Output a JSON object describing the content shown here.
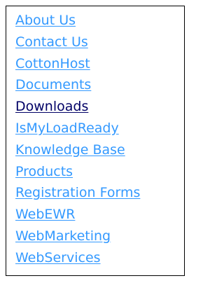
{
  "nav": {
    "link_color": "#3399ff",
    "active_color": "#000066",
    "items": [
      {
        "label": "About Us",
        "active": false
      },
      {
        "label": "Contact Us",
        "active": false
      },
      {
        "label": "CottonHost",
        "active": false
      },
      {
        "label": "Documents",
        "active": false
      },
      {
        "label": "Downloads",
        "active": true
      },
      {
        "label": "IsMyLoadReady",
        "active": false
      },
      {
        "label": "Knowledge Base",
        "active": false
      },
      {
        "label": "Products",
        "active": false
      },
      {
        "label": "Registration Forms",
        "active": false
      },
      {
        "label": "WebEWR",
        "active": false
      },
      {
        "label": "WebMarketing",
        "active": false
      },
      {
        "label": "WebServices",
        "active": false
      }
    ]
  }
}
